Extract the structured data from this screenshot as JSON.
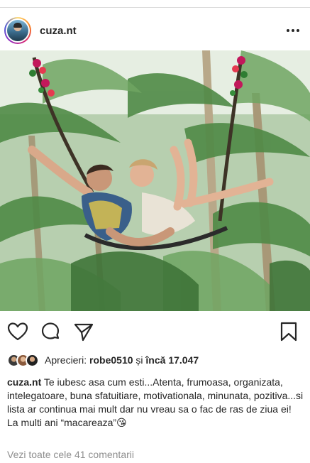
{
  "post": {
    "username": "cuza.nt",
    "more_icon": "more-horizontal-icon",
    "likes": {
      "prefix": "Aprecieri:",
      "first_liker": "robe0510",
      "connector": "și",
      "rest": "încă 17.047"
    },
    "caption": {
      "username": "cuza.nt",
      "text": "Te iubesc asa cum esti...Atenta, frumoasa, organizata, intelegatoare, buna sfatuitiare, motivationala, minunata, pozitiva...si lista ar continua mai mult dar nu vreau sa o fac de ras de ziua ei!",
      "line2": "La multi ani “macareaza”😘"
    },
    "comments_link": "Vezi toate cele 41 comentarii"
  },
  "icons": {
    "like": "heart-icon",
    "comment": "comment-icon",
    "share": "paper-plane-icon",
    "save": "bookmark-icon"
  }
}
